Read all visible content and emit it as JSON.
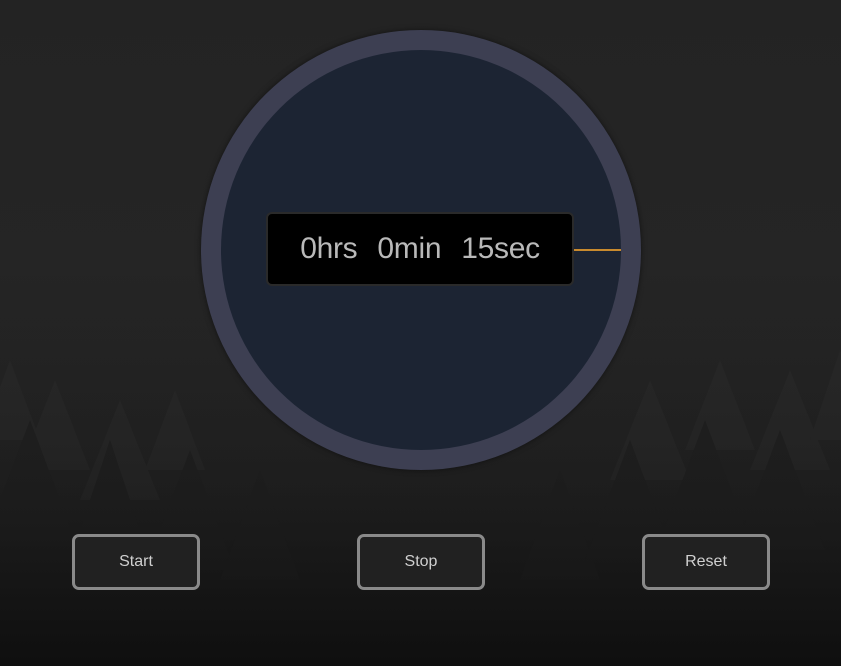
{
  "timer": {
    "hours": "0hrs",
    "minutes": "0min",
    "seconds": "15sec",
    "seconds_value": 15
  },
  "controls": {
    "start_label": "Start",
    "stop_label": "Stop",
    "reset_label": "Reset"
  },
  "colors": {
    "ring": "#3d3f52",
    "face": "#1c2433",
    "second_hand": "#c88a2e",
    "button_border": "#8a8a8a"
  }
}
